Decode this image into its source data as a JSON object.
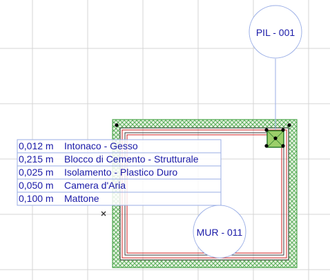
{
  "drawing": {
    "column_tag": "PIL - 001",
    "wall_tag": "MUR - 011",
    "layers": [
      {
        "thickness": "0,012 m",
        "material": "Intonaco - Gesso"
      },
      {
        "thickness": "0,215 m",
        "material": "Blocco di Cemento - Strutturale"
      },
      {
        "thickness": "0,025 m",
        "material": "Isolamento - Plastico Duro"
      },
      {
        "thickness": "0,050 m",
        "material": "Camera d'Aria"
      },
      {
        "thickness": "0,100 m",
        "material": "Mattone"
      }
    ]
  },
  "colors": {
    "grid": "#d4d4d4",
    "label_text": "#1a1aa8",
    "tag_line": "#9aaee6",
    "hatch_green": "#4fa84f",
    "wall_red": "#d02020",
    "handle": "#000000",
    "column_fill": "#9ccf6a"
  },
  "icons": {
    "label_anchor": "x-mark-icon",
    "selection_handle": "dot-handle-icon"
  }
}
